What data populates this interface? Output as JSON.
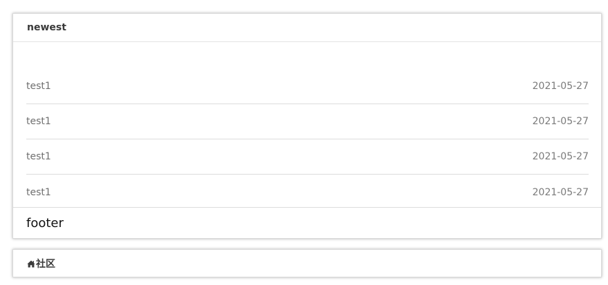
{
  "newest_panel": {
    "title": "newest",
    "items": [
      {
        "title": "test1",
        "date": "2021-05-27"
      },
      {
        "title": "test1",
        "date": "2021-05-27"
      },
      {
        "title": "test1",
        "date": "2021-05-27"
      },
      {
        "title": "test1",
        "date": "2021-05-27"
      }
    ],
    "footer": "footer"
  },
  "community_panel": {
    "icon": "home-icon",
    "title": "社区"
  }
}
